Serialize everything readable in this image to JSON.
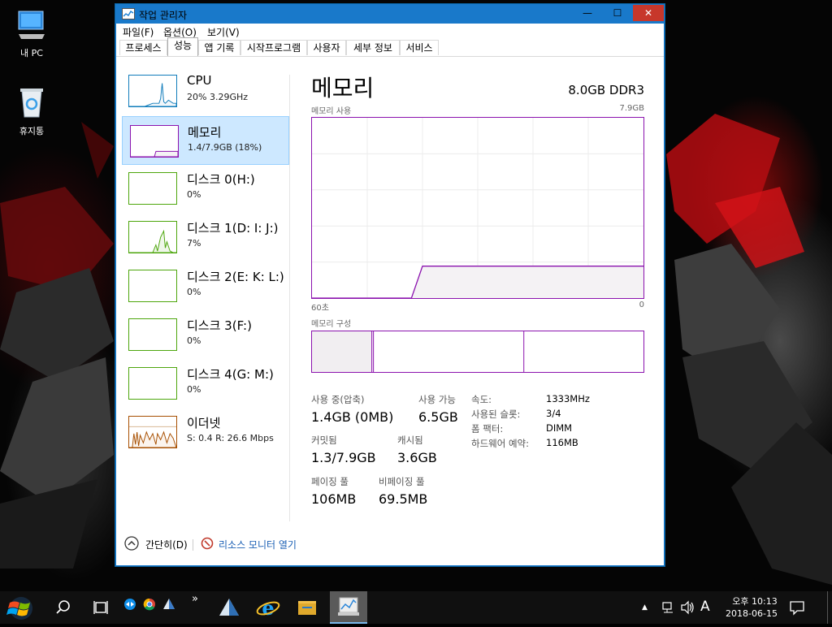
{
  "desktop": {
    "icons": [
      {
        "label": "내 PC",
        "icon": "computer-icon"
      },
      {
        "label": "휴지통",
        "icon": "recycle-bin-icon"
      }
    ]
  },
  "window": {
    "title": "작업 관리자",
    "controls": {
      "minimize": "—",
      "maximize": "☐",
      "close": "✕"
    },
    "menu": [
      "파일(F)",
      "옵션(O)",
      "보기(V)"
    ],
    "tabs": [
      "프로세스",
      "성능",
      "앱 기록",
      "시작프로그램",
      "사용자",
      "세부 정보",
      "서비스"
    ],
    "active_tab": "성능"
  },
  "sidebar": {
    "items": [
      {
        "name": "CPU",
        "value": "20% 3.29GHz",
        "color": "#117dbb"
      },
      {
        "name": "메모리",
        "value": "1.4/7.9GB (18%)",
        "color": "#8b12ae",
        "selected": true
      },
      {
        "name": "디스크 0(H:)",
        "value": "0%",
        "color": "#4da60c"
      },
      {
        "name": "디스크 1(D: I: J:)",
        "value": "7%",
        "color": "#4da60c"
      },
      {
        "name": "디스크 2(E: K: L:)",
        "value": "0%",
        "color": "#4da60c"
      },
      {
        "name": "디스크 3(F:)",
        "value": "0%",
        "color": "#4da60c"
      },
      {
        "name": "디스크 4(G: M:)",
        "value": "0%",
        "color": "#4da60c"
      },
      {
        "name": "이더넷",
        "value": "S: 0.4  R: 26.6 Mbps",
        "color": "#a74f01"
      }
    ]
  },
  "detail": {
    "title": "메모리",
    "capacity": "8.0GB DDR3",
    "graph_label": "메모리 사용",
    "graph_max": "7.9GB",
    "time_left": "60초",
    "time_right": "0",
    "composition_label": "메모리 구성",
    "stats": {
      "in_use_label": "사용 중(압축)",
      "in_use_value": "1.4GB (0MB)",
      "available_label": "사용 가능",
      "available_value": "6.5GB",
      "committed_label": "커밋됨",
      "committed_value": "1.3/7.9GB",
      "cached_label": "캐시됨",
      "cached_value": "3.6GB",
      "paged_label": "페이징 풀",
      "paged_value": "106MB",
      "nonpaged_label": "비페이징 풀",
      "nonpaged_value": "69.5MB"
    },
    "properties": [
      {
        "label": "속도:",
        "value": "1333MHz"
      },
      {
        "label": "사용된 슬롯:",
        "value": "3/4"
      },
      {
        "label": "폼 팩터:",
        "value": "DIMM"
      },
      {
        "label": "하드웨어 예약:",
        "value": "116MB"
      }
    ]
  },
  "chart_data": {
    "type": "area",
    "x": [
      60,
      42,
      40,
      0
    ],
    "y": [
      0,
      0,
      1.4,
      1.4
    ],
    "xlim": [
      60,
      0
    ],
    "ylim": [
      0,
      7.9
    ],
    "grid": true,
    "color": "#8b12ae"
  },
  "footer": {
    "collapse_label": "간단히(D)",
    "resource_monitor_label": "리소스 모니터 열기"
  },
  "taskbar": {
    "clock_time": "오후 10:13",
    "clock_date": "2018-06-15",
    "ime": "A",
    "overflow": "»"
  }
}
